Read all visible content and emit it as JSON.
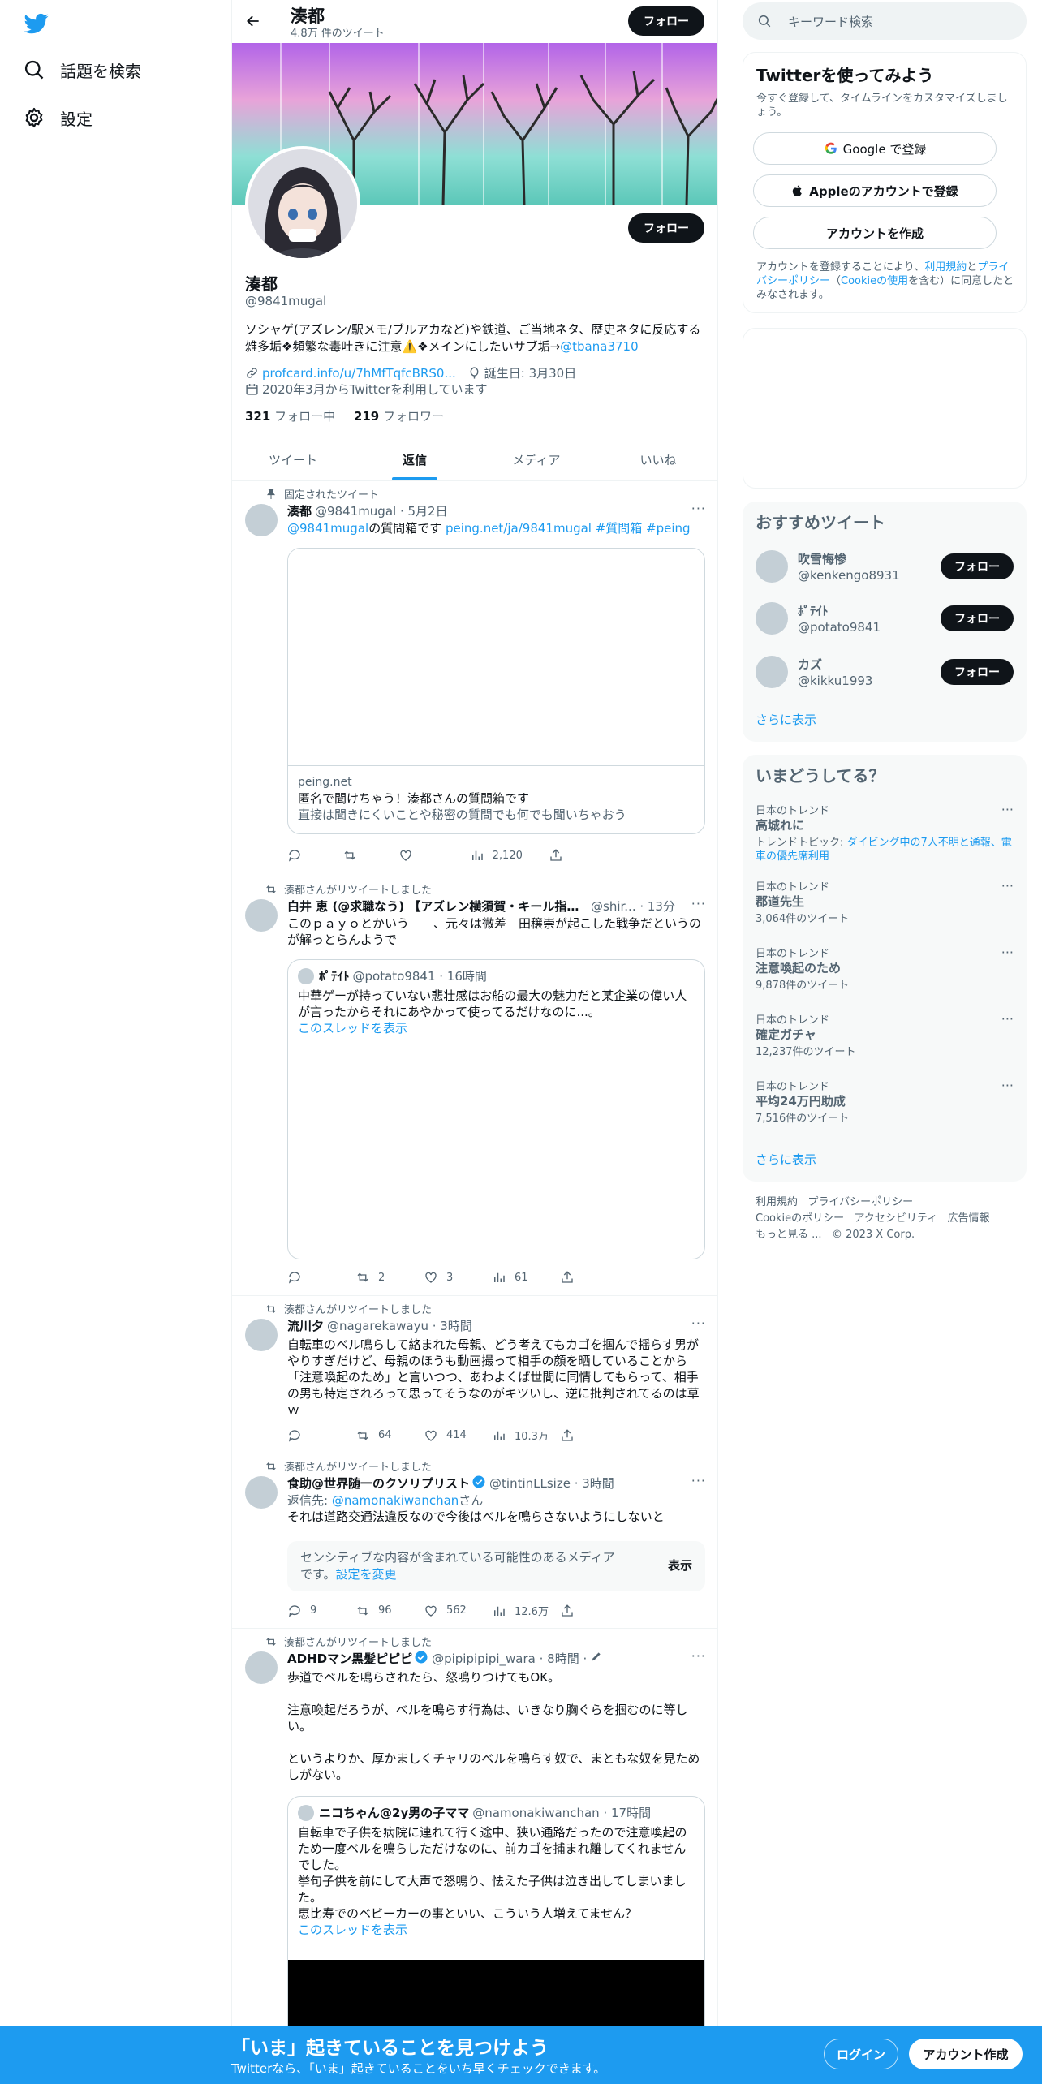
{
  "nav": {
    "explore": "話題を検索",
    "settings": "設定"
  },
  "header": {
    "name": "湊都",
    "tweet_count": "4.8万 件のツイート",
    "follow": "フォロー"
  },
  "profile": {
    "name": "湊都",
    "handle": "@9841mugal",
    "follow": "フォロー",
    "bio": "ソシャゲ(アズレン/駅メモ/ブルアカなど)や鉄道、ご当地ネタ、歴史ネタに反応する雑多垢❖頻繁な毒吐きに注意⚠️❖メインにしたいサブ垢→",
    "bio_link": "@tbana3710",
    "link": "profcard.info/u/7hMfTqfcBRS0...",
    "birthday": "誕生日: 3月30日",
    "joined": "2020年3月からTwitterを利用しています",
    "following_count": "321",
    "following_label": "フォロー中",
    "followers_count": "219",
    "followers_label": "フォロワー"
  },
  "tabs": [
    "ツイート",
    "返信",
    "メディア",
    "いいね"
  ],
  "tweets": {
    "t1": {
      "pinned": "固定されたツイート",
      "name": "湊都",
      "handle": "@9841mugal · 5月2日",
      "mention": "@9841mugal",
      "text": "の質問箱です",
      "link": "peing.net/ja/9841mugal #質問箱 #peing",
      "card_domain": "peing.net",
      "card_title": "匿名で聞けちゃう！湊都さんの質問箱です",
      "card_desc": "直接は聞きにくいことや秘密の質問でも何でも聞いちゃおう",
      "views": "2,120"
    },
    "t2": {
      "social": "湊都さんがリツイートしました",
      "name": "白井 恵 (@求職なう) 【アズレン横須賀・キール指揮...",
      "handle": "@shir... · 13分",
      "text": "このｐａｙｏとかいう　　、元々は微差　田穣崇が起こした戦争だというのが解っとらんようで",
      "q_name": "ﾎﾟﾃｲﾄ",
      "q_handle": "@potato9841 · 16時間",
      "q_text": "中華ゲーが持っていない悲壮感はお船の最大の魅力だと某企業の偉い人が言ったからそれにあやかって使ってるだけなのに...。",
      "q_thread": "このスレッドを表示",
      "retweets": "2",
      "likes": "3",
      "views": "61"
    },
    "t3": {
      "social": "湊都さんがリツイートしました",
      "name": "流川夕",
      "handle": "@nagarekawayu · 3時間",
      "text": "自転車のベル鳴らして絡まれた母親、どう考えてもカゴを掴んで揺らす男がやりすぎだけど、母親のほうも動画撮って相手の顔を晒していることから「注意喚起のため」と言いつつ、あわよくば世間に同情してもらって、相手の男も特定されろって思ってそうなのがキツいし、逆に批判されてるのは草ｗ",
      "retweets": "64",
      "likes": "414",
      "views": "10.3万"
    },
    "t4": {
      "social": "湊都さんがリツイートしました",
      "name": "食助@世界随一のクソリプリスト",
      "handle": "@tintinLLsize · 3時間",
      "reply_to_label": "返信先: ",
      "reply_to": "@namonakiwanchan",
      "reply_to_suffix": "さん",
      "text": "それは道路交通法違反なので今後はベルを鳴らさないようにしないと",
      "sensitive": "センシティブな内容が含まれている可能性のあるメディアです。",
      "sensitive_link": "設定を変更",
      "show": "表示",
      "replies": "9",
      "retweets": "96",
      "likes": "562",
      "views": "12.6万"
    },
    "t5": {
      "social": "湊都さんがリツイートしました",
      "name": "ADHDマン黒髪ピピピ",
      "handle": "@pipipipipi_wara · 8時間 ·",
      "text": "歩道でベルを鳴らされたら、怒鳴りつけてもOK。\n\n注意喚起だろうが、ベルを鳴らす行為は、いきなり胸ぐらを掴むのに等しい。\n\nというよりか、厚かましくチャリのベルを鳴らす奴で、まともな奴を見ためしがない。",
      "q_name": "ニコちゃん@2y男の子ママ",
      "q_handle": "@namonakiwanchan · 17時間",
      "q_text": "自転車で子供を病院に連れて行く途中、狭い通路だったので注意喚起のため一度ベルを鳴らしただけなのに、前カゴを捕まれ離してくれませんでした。\n挙句子供を前にして大声で怒鳴り、怯えた子供は泣き出してしまいました。\n恵比寿でのベビーカーの事といい、こういう人増えてません？",
      "q_thread": "このスレッドを表示"
    }
  },
  "right": {
    "search_placeholder": "キーワード検索",
    "signup": {
      "title": "Twitterを使ってみよう",
      "subtitle": "今すぐ登録して、タイムラインをカスタマイズしましょう。",
      "google": "Google で登録",
      "apple": "Appleのアカウントで登録",
      "create": "アカウントを作成",
      "terms_1": "アカウントを登録することにより、",
      "terms_link1": "利用規約",
      "terms_2": "と",
      "terms_link2": "プライバシーポリシー",
      "terms_3": "（",
      "terms_link3": "Cookieの使用",
      "terms_4": "を含む）に同意したとみなされます。"
    },
    "recommend": {
      "title": "おすすめツイート",
      "users": [
        {
          "name": "吹雪悔惨",
          "handle": "@kenkengo8931"
        },
        {
          "name": "ﾎﾟﾃｲﾄ",
          "handle": "@potato9841"
        },
        {
          "name": "カズ",
          "handle": "@kikku1993"
        }
      ],
      "follow": "フォロー",
      "more": "さらに表示"
    },
    "trends": {
      "title": "いまどうしてる？",
      "items": [
        {
          "context": "日本のトレンド",
          "title": "高城れに",
          "sub_label": "トレンドトピック: ",
          "sub": "ダイビング中の7人不明と通報、電車の優先席利用"
        },
        {
          "context": "日本のトレンド",
          "title": "郡道先生",
          "sub": "3,064件のツイート"
        },
        {
          "context": "日本のトレンド",
          "title": "注意喚起のため",
          "sub": "9,878件のツイート"
        },
        {
          "context": "日本のトレンド",
          "title": "確定ガチャ",
          "sub": "12,237件のツイート"
        },
        {
          "context": "日本のトレンド",
          "title": "平均24万円助成",
          "sub": "7,516件のツイート"
        }
      ],
      "more": "さらに表示"
    },
    "footer": {
      "terms": "利用規約",
      "privacy": "プライバシーポリシー",
      "cookie": "Cookieのポリシー",
      "accessibility": "アクセシビリティ",
      "ads": "広告情報",
      "more": "もっと見る ...",
      "copyright": "© 2023 X Corp."
    }
  },
  "bottom": {
    "title": "「いま」起きていることを見つけよう",
    "subtitle": "Twitterなら、「いま」起きていることをいち早くチェックできます。",
    "login": "ログイン",
    "signup": "アカウント作成"
  },
  "colors": {
    "accent": "#1d9bf0",
    "text": "#0f1419",
    "secondary": "#536471"
  }
}
